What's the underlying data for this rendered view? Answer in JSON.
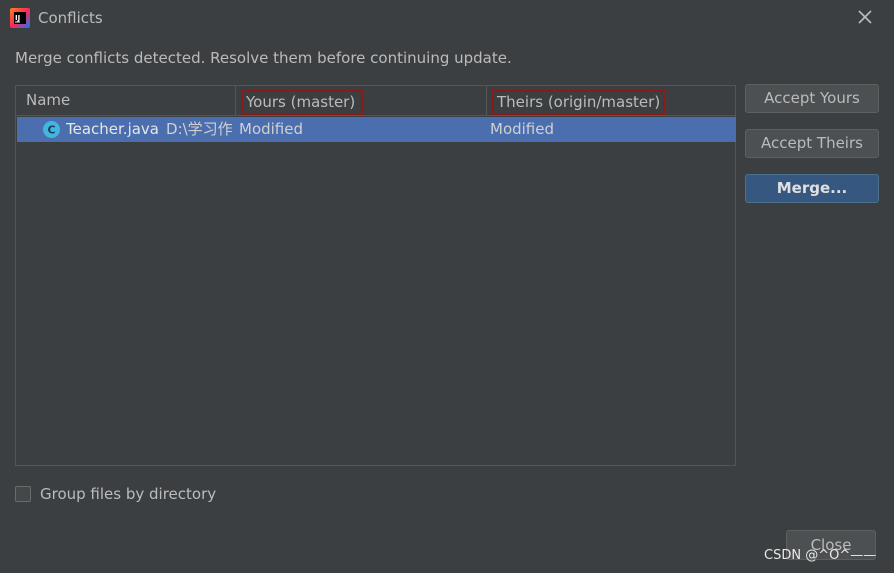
{
  "window": {
    "title": "Conflicts",
    "app_icon": "intellij-idea-icon",
    "close_icon": "close-icon"
  },
  "message": "Merge conflicts detected. Resolve them before continuing update.",
  "table": {
    "columns": [
      "Name",
      "Yours (master)",
      "Theirs (origin/master)"
    ],
    "rows": [
      {
        "icon": "java-class-icon",
        "icon_letter": "C",
        "name": "Teacher.java",
        "path": "D:\\学习作",
        "yours": "Modified",
        "theirs": "Modified",
        "selected": true
      }
    ]
  },
  "buttons": {
    "accept_yours": "Accept Yours",
    "accept_theirs": "Accept Theirs",
    "merge": "Merge...",
    "close": "Close"
  },
  "options": {
    "group_by_directory_label": "Group files by directory",
    "group_by_directory_checked": false
  },
  "watermark": "CSDN @^O^——",
  "colors": {
    "background": "#3c3f41",
    "selection": "#4b6eaf",
    "default_button": "#365880",
    "highlight_box": "#8b1a1a"
  }
}
